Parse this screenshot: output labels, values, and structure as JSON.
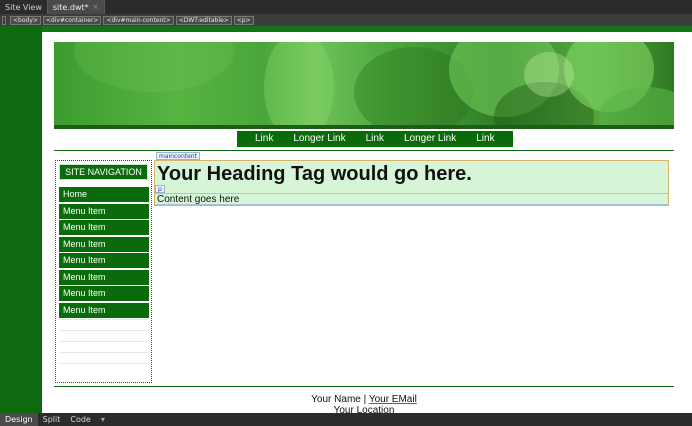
{
  "tabs": {
    "site_view": "Site View",
    "document": "site.dwt*",
    "close_glyph": "×"
  },
  "tag_selector": [
    "<body>",
    "<div#container>",
    "<div#main-content>",
    "<DWT:editable>",
    "<p>"
  ],
  "page": {
    "top_nav": [
      "Link",
      "Longer Link",
      "Link",
      "Longer Link",
      "Link"
    ],
    "main_content_label": "maincontent",
    "sidebar": {
      "heading": "SITE NAVIGATION",
      "items": [
        "Home",
        "Menu Item",
        "Menu Item",
        "Menu Item",
        "Menu Item",
        "Menu Item",
        "Menu Item",
        "Menu Item"
      ]
    },
    "heading": "Your Heading Tag would go here.",
    "p_label": "p",
    "content": "Content goes here",
    "footer": {
      "name": "Your Name",
      "separator": " | ",
      "email": "Your EMail",
      "location": "Your Location"
    }
  },
  "view_bar": {
    "design": "Design",
    "split": "Split",
    "code": "Code",
    "more_glyph": "▾"
  },
  "colors": {
    "nav_green": "#0b6b0b",
    "canvas_green": "#167216",
    "editable_bg": "#d6f5d6"
  }
}
